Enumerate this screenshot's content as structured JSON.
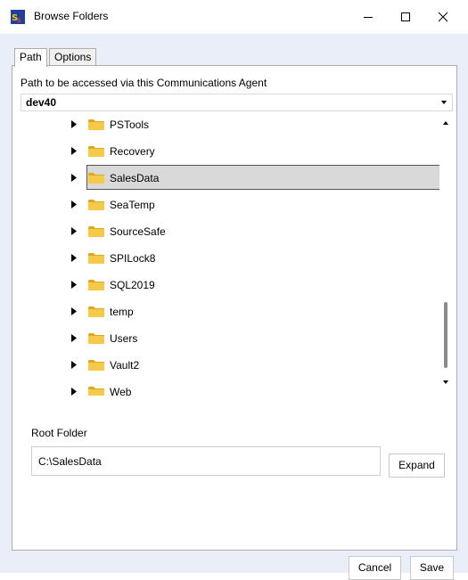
{
  "window": {
    "title": "Browse Folders",
    "icon": "app-logo-icon",
    "controls": [
      "minimize-icon",
      "maximize-icon",
      "close-icon"
    ]
  },
  "tabs": [
    {
      "label": "Path",
      "active": true
    },
    {
      "label": "Options",
      "active": false
    }
  ],
  "path_section": {
    "label": "Path to be accessed via this Communications Agent",
    "selected_agent": "dev40"
  },
  "tree": {
    "items": [
      {
        "name": "PSTools",
        "selected": false
      },
      {
        "name": "Recovery",
        "selected": false
      },
      {
        "name": "SalesData",
        "selected": true
      },
      {
        "name": "SeaTemp",
        "selected": false
      },
      {
        "name": "SourceSafe",
        "selected": false
      },
      {
        "name": "SPILock8",
        "selected": false
      },
      {
        "name": "SQL2019",
        "selected": false
      },
      {
        "name": "temp",
        "selected": false
      },
      {
        "name": "Users",
        "selected": false
      },
      {
        "name": "Vault2",
        "selected": false
      },
      {
        "name": "Web",
        "selected": false
      }
    ],
    "icons": {
      "expander": "expand-arrow-icon",
      "folder": "folder-icon"
    }
  },
  "root_folder": {
    "label": "Root Folder",
    "value": "C:\\SalesData",
    "expand_label": "Expand"
  },
  "footer": {
    "cancel_label": "Cancel",
    "save_label": "Save"
  },
  "colors": {
    "client_background": "#e9eef8",
    "folder_yellow": "#f7c948",
    "selection_fill": "#d9d9d9"
  }
}
